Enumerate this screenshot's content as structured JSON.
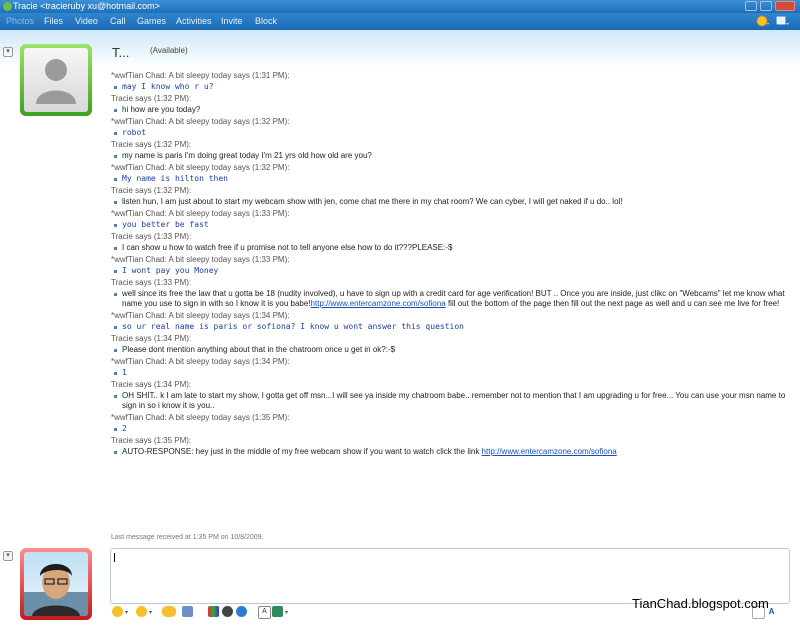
{
  "window": {
    "title": "Tracie <tracieruby xu@hotmail.com>"
  },
  "menu": {
    "items": [
      "Photos",
      "Files",
      "Video",
      "Call",
      "Games",
      "Activities",
      "Invite",
      "Block"
    ]
  },
  "contact": {
    "name": "T...",
    "status": "(Available)"
  },
  "conversation": [
    {
      "sender": "*wwfTian Chad: A bit sleepy today says (1:31 PM):",
      "text": "may I know who r u?",
      "mine": true
    },
    {
      "sender": "Tracie says (1:32 PM):",
      "text": "hi how are you today?",
      "mine": false
    },
    {
      "sender": "*wwfTian Chad: A bit sleepy today says (1:32 PM):",
      "text": "robot",
      "mine": true
    },
    {
      "sender": "Tracie says (1:32 PM):",
      "text": "my name is  paris I'm doing great today I'm 21 yrs old how old are you?",
      "mine": false
    },
    {
      "sender": "*wwfTian Chad: A bit sleepy today says (1:32 PM):",
      "text": "My name is hilton then",
      "mine": true
    },
    {
      "sender": "Tracie says (1:32 PM):",
      "text": "listen hun, I am just about to start my webcam show with jen, come chat me there in my chat room? We can cyber, I will get naked if u do.. lol!",
      "mine": false
    },
    {
      "sender": "*wwfTian Chad: A bit sleepy today says (1:33 PM):",
      "text": "you better be fast",
      "mine": true
    },
    {
      "sender": "Tracie says (1:33 PM):",
      "text": "I can show u how to watch free if u promise not to tell anyone else how to do it???PLEASE:-$",
      "mine": false
    },
    {
      "sender": "*wwfTian Chad: A bit sleepy today says (1:33 PM):",
      "text": "I wont pay you Money",
      "mine": true
    },
    {
      "sender": "Tracie says (1:33 PM):",
      "text": "well since its free the law that u gotta be 18 (nudity involved), u have to sign up with a credit card for age verification! BUT .. Once you are inside, just clikc on \"Webcams\" let me know what name you use to sign in with so I know it is you babe!",
      "link": "http://www.entercamzone.com/sofiona",
      "text_after": "  fill out the bottom of the page then fill out the next page as well and u can see me live for free!",
      "mine": false
    },
    {
      "sender": "*wwfTian Chad: A bit sleepy today says (1:34 PM):",
      "text": "so ur real name is paris or sofiona? I know u wont answer this question",
      "mine": true
    },
    {
      "sender": "Tracie says (1:34 PM):",
      "text": "Please dont mention anything about that in the chatroom once u get in ok?:-$",
      "mine": false
    },
    {
      "sender": "*wwfTian Chad: A bit sleepy today says (1:34 PM):",
      "text": "1",
      "mine": true
    },
    {
      "sender": "Tracie says (1:34 PM):",
      "text": "OH SHIT.. k I am late to start my show, I gotta get off msn...I will see ya inside my chatroom babe.. remember not to mention that I am upgrading u for free... You can use your msn name to sign in so i know it is you..",
      "mine": false
    },
    {
      "sender": "*wwfTian Chad: A bit sleepy today says (1:35 PM):",
      "text": "2",
      "mine": true
    },
    {
      "sender": "Tracie says (1:35 PM):",
      "text": "AUTO-RESPONSE: hey just in the middle of my free webcam show if you want to watch click the link ",
      "link": "http://www.entercamzone.com/sofiona",
      "mine": false
    }
  ],
  "footer": {
    "last_message": "Last message received at 1:35 PM on 10/8/2009."
  },
  "watermark": "TianChad.blogspot.com",
  "colors": {
    "titlebar": "#1e6fb8",
    "contact_frame": "#3fa11c",
    "self_frame": "#c41a1a",
    "my_text": "#1a3fa0"
  },
  "icons": {
    "toolbar": [
      "emoticon-icon",
      "wink-icon",
      "nudge-icon",
      "voice-clip-icon",
      "background-icon",
      "ink-icon",
      "font-icon",
      "color-icon",
      "handwriting-icon",
      "text-icon"
    ]
  }
}
